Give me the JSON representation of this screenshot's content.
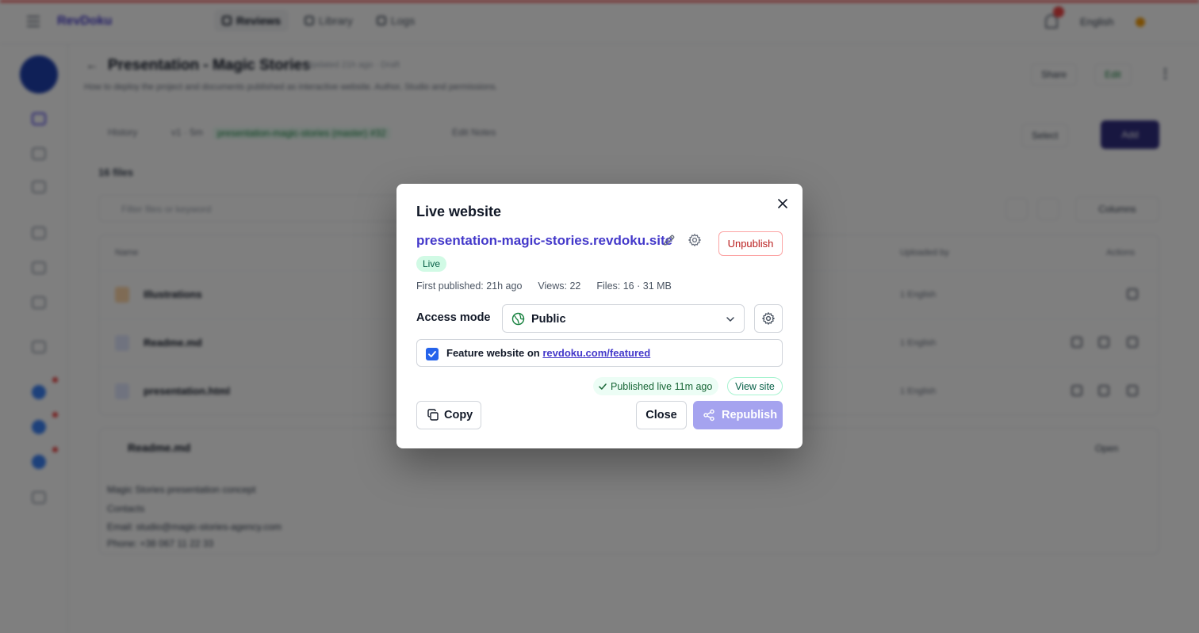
{
  "app": {
    "brand": "RevDoku",
    "nav": [
      {
        "label": "Reviews"
      },
      {
        "label": "Library"
      },
      {
        "label": "Logs"
      }
    ],
    "notifications_count": "1",
    "user_label": "English"
  },
  "page": {
    "back_label": "←",
    "title": "Presentation - Magic Stories",
    "meta": "Updated 21h ago · Draft",
    "description": "How to deploy the project and documents published as interactive website. Author, Studio and permissions.",
    "header_buttons": {
      "share": "Share",
      "edit": "Edit"
    },
    "toolbar": {
      "history": "History",
      "ref": "v1 · 5m",
      "branch": "presentation-magic-stories (master) #32",
      "actions": "Edit Notes",
      "select": "Select",
      "add": "Add"
    },
    "files_count": "16 files",
    "filter_placeholder": "Filter files or keyword",
    "columns_label": "Columns",
    "table": {
      "headers": [
        "Name",
        "Uploaded by",
        "Actions"
      ],
      "rows": [
        {
          "name": "Illustrations",
          "by": "1 English",
          "icon_color": "#fed7aa"
        },
        {
          "name": "Readme.md",
          "by": "1 English",
          "icon_color": "#e0e7ff"
        },
        {
          "name": "presentation.html",
          "by": "1 English",
          "icon_color": "#e0e7ff"
        }
      ]
    },
    "readme": {
      "title": "Readme.md",
      "open": "Open",
      "lines": [
        "Magic Stories presentation concept",
        "Contacts",
        "Email: studio@magic-stories-agency.com",
        "Phone: +38 067 11 22 33"
      ]
    }
  },
  "modal": {
    "title": "Live website",
    "site_url": "presentation-magic-stories.revdoku.site",
    "unpublish_label": "Unpublish",
    "status_badge": "Live",
    "stats": {
      "first_published": "First published: 21h ago",
      "views": "Views: 22",
      "files": "Files: 16 · 31 MB"
    },
    "access": {
      "label": "Access mode",
      "value": "Public",
      "icon": "globe-icon"
    },
    "feature": {
      "checked": true,
      "text": "Feature website on ",
      "link": "revdoku.com/featured"
    },
    "published_status": "Published live 11m ago",
    "view_site_label": "View site",
    "buttons": {
      "copy": "Copy",
      "close": "Close",
      "republish": "Republish"
    },
    "colors": {
      "accent": "#4338ca",
      "danger": "#b91c1c",
      "success": "#065f46",
      "republish_disabled": "#a5a3ef"
    }
  }
}
